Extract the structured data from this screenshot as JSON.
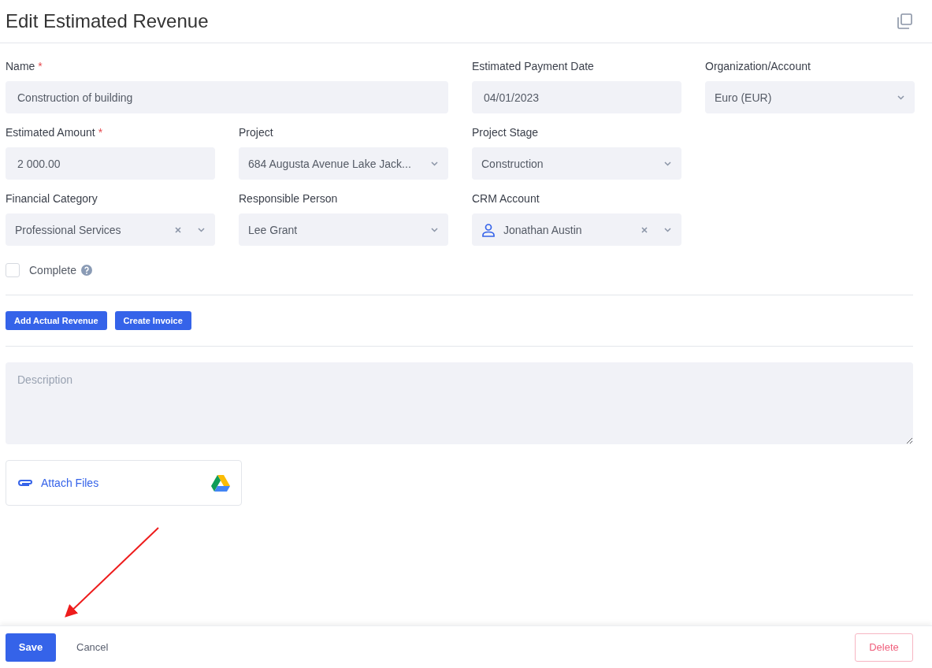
{
  "header": {
    "title": "Edit Estimated Revenue"
  },
  "field_rows": [
    [
      {
        "label": "Name",
        "required_mark": "*",
        "kind": "text",
        "wide": true,
        "value": "Construction of building"
      },
      {
        "label": "Estimated Payment Date",
        "kind": "text",
        "wide": false,
        "value": "04/01/2023"
      },
      {
        "label": "Organization/Account",
        "kind": "select",
        "wide": false,
        "value": "Euro (EUR)",
        "clearable": false
      }
    ],
    [
      {
        "label": "Estimated Amount",
        "required_mark": "*",
        "kind": "text",
        "wide": false,
        "value": "2 000.00"
      },
      {
        "label": "Project",
        "kind": "select",
        "wide": false,
        "value": "684 Augusta Avenue Lake Jack...",
        "clearable": false
      },
      {
        "label": "Project Stage",
        "kind": "select",
        "wide": false,
        "value": "Construction",
        "clearable": false
      }
    ],
    [
      {
        "label": "Financial Category",
        "kind": "select",
        "wide": false,
        "value": "Professional Services",
        "clearable": true
      },
      {
        "label": "Responsible Person",
        "kind": "select",
        "wide": false,
        "value": "Lee Grant",
        "clearable": false
      },
      {
        "label": "CRM Account",
        "kind": "person",
        "wide": false,
        "value": "Jonathan Austin",
        "clearable": true
      }
    ]
  ],
  "complete": {
    "label": "Complete",
    "checked": false
  },
  "actions": [
    "Add Actual Revenue",
    "Create Invoice"
  ],
  "description": {
    "placeholder": "Description"
  },
  "attach": {
    "label": "Attach Files"
  },
  "footer": {
    "save": "Save",
    "cancel": "Cancel",
    "delete": "Delete"
  }
}
